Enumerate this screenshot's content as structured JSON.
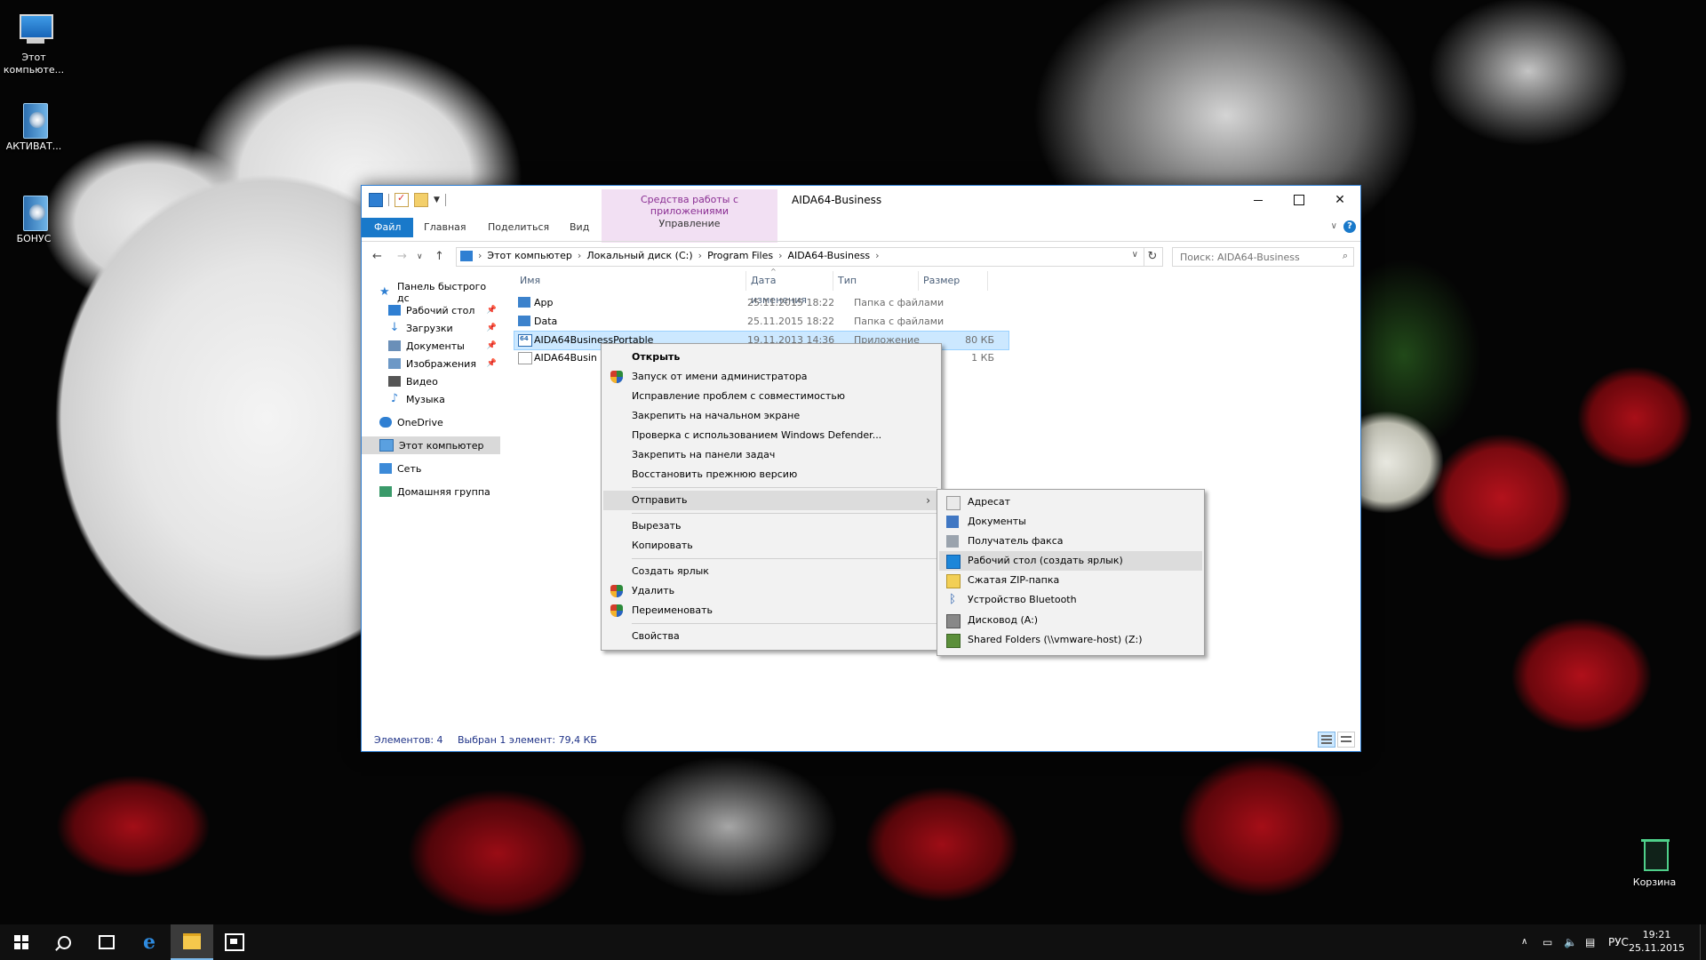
{
  "desktop": {
    "icons": [
      {
        "label": "Этот компьюте..."
      },
      {
        "label": "АКТИВАТ..."
      },
      {
        "label": "БОНУС"
      },
      {
        "label": "Корзина"
      }
    ]
  },
  "window": {
    "title": "AIDA64-Business",
    "tool_tab_title": "Средства работы с приложениями",
    "tool_tab_sub": "Управление",
    "ribbon_tabs": [
      "Файл",
      "Главная",
      "Поделиться",
      "Вид"
    ],
    "breadcrumb": [
      "Этот компьютер",
      "Локальный диск (C:)",
      "Program Files",
      "AIDA64-Business"
    ],
    "search_placeholder": "Поиск: AIDA64-Business",
    "nav": {
      "quick_access": "Панель быстрого дс",
      "items": [
        "Рабочий стол",
        "Загрузки",
        "Документы",
        "Изображения",
        "Видео",
        "Музыка"
      ],
      "onedrive": "OneDrive",
      "this_pc": "Этот компьютер",
      "network": "Сеть",
      "homegroup": "Домашняя группа"
    },
    "columns": [
      "Имя",
      "Дата изменения",
      "Тип",
      "Размер"
    ],
    "files": [
      {
        "name": "App",
        "date": "25.11.2015 18:22",
        "type": "Папка с файлами",
        "size": ""
      },
      {
        "name": "Data",
        "date": "25.11.2015 18:22",
        "type": "Папка с файлами",
        "size": ""
      },
      {
        "name": "AIDA64BusinessPortable",
        "date": "19.11.2013 14:36",
        "type": "Приложение",
        "size": "80 КБ"
      },
      {
        "name": "AIDA64Busin",
        "date": "",
        "type": "...",
        "size": "1 КБ"
      }
    ],
    "status": {
      "count": "Элементов: 4",
      "selected": "Выбран 1 элемент: 79,4 КБ"
    }
  },
  "context_menu": {
    "items": [
      "Открыть",
      "Запуск от имени администратора",
      "Исправление проблем с совместимостью",
      "Закрепить на начальном экране",
      "Проверка с использованием Windows Defender...",
      "Закрепить на панели задач",
      "Восстановить прежнюю версию",
      "Отправить",
      "Вырезать",
      "Копировать",
      "Создать ярлык",
      "Удалить",
      "Переименовать",
      "Свойства"
    ]
  },
  "send_to_menu": {
    "items": [
      "Адресат",
      "Документы",
      "Получатель факса",
      "Рабочий стол (создать ярлык)",
      "Сжатая ZIP-папка",
      "Устройство Bluetooth",
      "Дисковод (A:)",
      "Shared Folders (\\\\vmware-host) (Z:)"
    ]
  },
  "taskbar": {
    "language": "РУС",
    "time": "19:21",
    "date": "25.11.2015",
    "edge_letter": "e"
  },
  "colors": {
    "accent": "#1979ca",
    "selection": "#cce8ff",
    "tool_tab": "#f2e0f3"
  }
}
